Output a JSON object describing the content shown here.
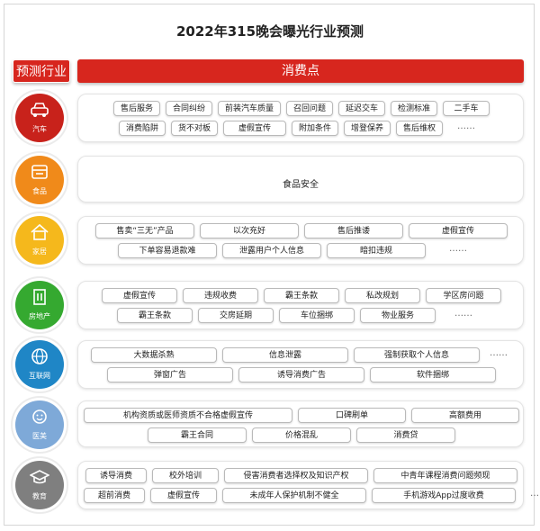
{
  "title": "2022年315晚会曝光行业预测",
  "header": {
    "left": "预测行业",
    "right": "消费点"
  },
  "colors": {
    "row1": "#c8221b",
    "row2": "#f08a1a",
    "row3": "#f5b81c",
    "row4": "#35a930",
    "row5": "#1f86c6",
    "row6": "#7ea9d8",
    "row7": "#7f7f7f",
    "header": "#d7261e"
  },
  "rows": [
    {
      "label": "汽车",
      "icon": "car-icon",
      "lines": [
        [
          "售后服务",
          "合同纠纷",
          "前装汽车质量",
          "召回问题",
          "延迟交车",
          "检测标准",
          "二手车"
        ],
        [
          "消费陷阱",
          "货不对板",
          "虚假宣传",
          "附加条件",
          "增登保养",
          "售后维权",
          "……"
        ]
      ]
    },
    {
      "label": "食品",
      "icon": "food-icon",
      "lines": [
        [
          "食品安全"
        ]
      ]
    },
    {
      "label": "家居",
      "icon": "home-icon",
      "lines": [
        [
          "售卖“三无”产品",
          "以次充好",
          "售后推诿",
          "虚假宣传"
        ],
        [
          "下单容易退款难",
          "泄露用户个人信息",
          "暗扣违规",
          "……"
        ]
      ]
    },
    {
      "label": "房地产",
      "icon": "building-icon",
      "lines": [
        [
          "虚假宣传",
          "违规收费",
          "霸王条款",
          "私改规划",
          "学区房问题"
        ],
        [
          "霸王条款",
          "交房延期",
          "车位捆绑",
          "物业服务",
          "……"
        ]
      ]
    },
    {
      "label": "互联网",
      "icon": "internet-icon",
      "lines": [
        [
          "大数据杀熟",
          "信息泄露",
          "强制获取个人信息",
          "……"
        ],
        [
          "弹窗广告",
          "诱导消费广告",
          "软件捆绑"
        ]
      ]
    },
    {
      "label": "医美",
      "icon": "beauty-icon",
      "lines": [
        [
          "机构资质或医师资质不合格虚假宣传",
          "口碑刷单",
          "高额费用"
        ],
        [
          "霸王合同",
          "价格混乱",
          "消费贷"
        ]
      ]
    },
    {
      "label": "教育",
      "icon": "education-icon",
      "lines": [
        [
          "诱导消费",
          "校外培训",
          "侵害消费者选择权及知识产权",
          "中青年课程消费问题频现"
        ],
        [
          "超前消费",
          "虚假宣传",
          "未成年人保护机制不健全",
          "手机游戏App过度收费",
          "……"
        ]
      ]
    }
  ]
}
